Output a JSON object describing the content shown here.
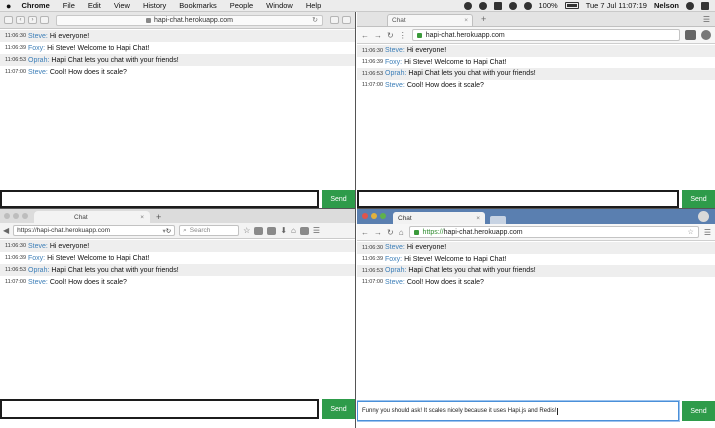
{
  "menubar": {
    "app": "Chrome",
    "items": [
      "File",
      "Edit",
      "View",
      "History",
      "Bookmarks",
      "People",
      "Window",
      "Help"
    ],
    "battery": "100%",
    "clock": "Tue 7 Jul  11:07:19",
    "user": "Nelson"
  },
  "chat": {
    "messages": [
      {
        "time": "11:06:30",
        "user": "Steve:",
        "text": "Hi everyone!"
      },
      {
        "time": "11:06:39",
        "user": "Foxy:",
        "text": "Hi Steve! Welcome to Hapi Chat!"
      },
      {
        "time": "11:06:53",
        "user": "Oprah:",
        "text": "Hapi Chat lets you chat with your friends!"
      },
      {
        "time": "11:07:00",
        "user": "Steve:",
        "text": "Cool! How does it scale?"
      }
    ],
    "send_label": "Send"
  },
  "windows": {
    "top_left": {
      "address": "hapi-chat.herokuapp.com",
      "input_value": ""
    },
    "top_right": {
      "tab_title": "Chat",
      "address": "hapi-chat.herokuapp.com",
      "input_value": ""
    },
    "bottom_left": {
      "tab_title": "Chat",
      "address": "https://hapi-chat.herokuapp.com",
      "search_placeholder": "Search",
      "input_value": ""
    },
    "bottom_right": {
      "tab_title": "Chat",
      "address_scheme": "https://",
      "address_host": "hapi-chat.herokuapp.com",
      "input_value": "Funny you should ask! It scales nicely because it uses Hapi.js and Redis!"
    }
  },
  "colors": {
    "send": "#2e9b4a",
    "username": "#3d7fb8",
    "row_alt": "#eeeeee"
  }
}
